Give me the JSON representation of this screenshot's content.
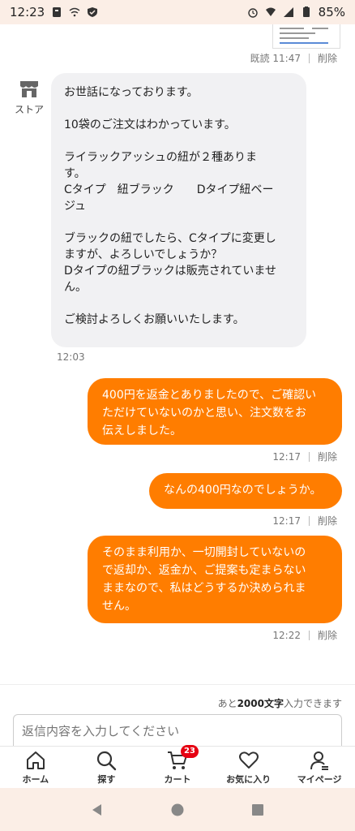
{
  "status_bar": {
    "time": "12:23",
    "battery": "85%"
  },
  "attachment_meta": {
    "read_label": "既読 11:47",
    "delete_label": "削除"
  },
  "store": {
    "label": "ストア"
  },
  "incoming_message": {
    "text": "お世話になっております。\n\n10袋のご注文はわかっています。\n\nライラックアッシュの紐が２種ありま\nす。\nCタイプ　紐ブラック　　Dタイプ紐ベー\nジュ\n\nブラックの紐でしたら、Cタイプに変更し\nますが、よろしいでしょうか？\nDタイプの紐ブラックは販売されていませ\nん。\n\nご検討よろしくお願いいたします。",
    "time": "12:03"
  },
  "outgoing_messages": [
    {
      "text": "400円を返金とありましたので、ご確認い\nただけていないのかと思い、注文数をお\n伝えしました。",
      "time": "12:17",
      "delete_label": "削除"
    },
    {
      "text": "なんの400円なのでしょうか。",
      "time": "12:17",
      "delete_label": "削除"
    },
    {
      "text": "そのまま利用か、一切開封していないの\nで返却か、返金か、ご提案も定まらない\nままなので、私はどうするか決められま\nせん。",
      "time": "12:22",
      "delete_label": "削除"
    }
  ],
  "input": {
    "char_prefix": "あと",
    "char_count": "2000文字",
    "char_suffix": "入力できます",
    "placeholder": "返信内容を入力してください"
  },
  "nav": {
    "items": [
      {
        "label": "ホーム",
        "icon": "home-icon"
      },
      {
        "label": "探す",
        "icon": "search-icon"
      },
      {
        "label": "カート",
        "icon": "cart-icon"
      },
      {
        "label": "お気に入り",
        "icon": "heart-icon"
      },
      {
        "label": "マイページ",
        "icon": "user-icon"
      }
    ],
    "cart_badge": "23"
  },
  "colors": {
    "accent": "#ff7d00",
    "badge": "#e60012",
    "bubble_in": "#f1f1f3",
    "system_bar": "#fbeee6"
  }
}
